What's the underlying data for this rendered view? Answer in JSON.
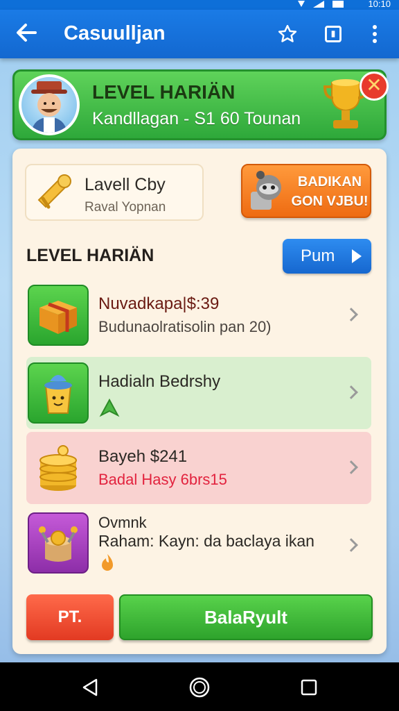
{
  "status_bar": {
    "time": "10:10"
  },
  "app_bar": {
    "title": "Casuulljan",
    "icons": [
      "back-arrow-icon",
      "star-icon",
      "square-icon",
      "more-vert-icon"
    ]
  },
  "hero": {
    "title": "LEVEL HARIÄN",
    "subtitle": "Kandllagan - S1 60 Tounan"
  },
  "card": {
    "mini_card": {
      "title": "Lavell Cby",
      "subtitle": "Raval Yopnan"
    },
    "orange_button": {
      "line1": "BADIKAN",
      "line2": "GON VJBU!"
    },
    "section_title": "LEVEL HARIÄN",
    "blue_button": {
      "label": "Pum"
    },
    "rows": [
      {
        "title": "Nuvadkapa|$:39",
        "subtitle": "Budunaolratisolin pan 20)",
        "icon": "gift-box-icon",
        "bg": "#fdf3e4"
      },
      {
        "title": "Hadialn Bedrshy",
        "subtitle": "",
        "icon": "honey-pot-icon",
        "bg": "#d9efcf"
      },
      {
        "title": "Bayeh $241",
        "subtitle": "Badal Hasy 6brs15",
        "icon": "coin-stack-icon",
        "bg": "#f9d2d0"
      },
      {
        "title": "Ovmnk",
        "subtitle": "Raham: Kayn: da baclaya ikan",
        "icon": "money-bag-icon",
        "bg": "#fdf3e4"
      }
    ],
    "bottom": {
      "left_label": "PT.",
      "right_label": "BalaRyult"
    }
  },
  "colors": {
    "primary_blue": "#1368d0",
    "hero_green": "#2ea83a",
    "orange": "#ee6b12",
    "red": "#e23a22",
    "red_text": "#e2233e"
  }
}
